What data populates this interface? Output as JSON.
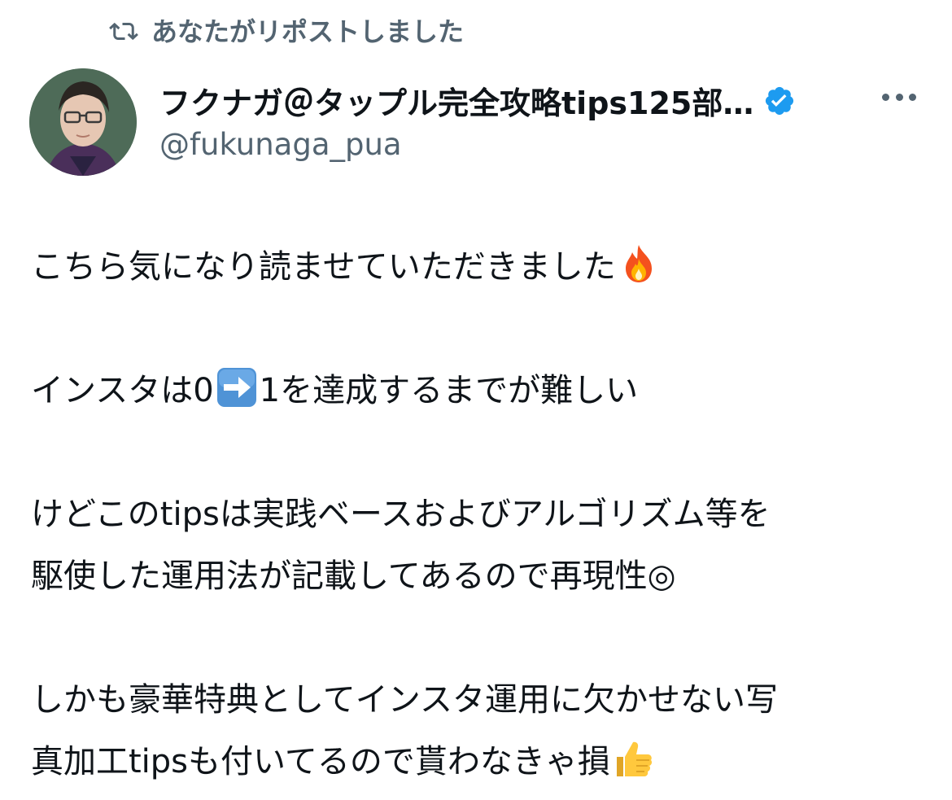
{
  "repost": {
    "icon": "repost-icon",
    "label": "あなたがリポストしました"
  },
  "author": {
    "display_name": "フクナガ＠タップル完全攻略tips125部…",
    "handle": "@fukunaga_pua",
    "verified": true,
    "avatar_icon": "avatar"
  },
  "menu": {
    "icon": "more-icon"
  },
  "tweet": {
    "line1_text": "こちら気になり読ませていただきました",
    "line1_emoji": "fire-emoji",
    "line2_a": "インスタは0",
    "line2_emoji": "right-arrow-emoji",
    "line2_b": "1を達成するまでが難しい",
    "line3": "けどこのtipsは実践ベースおよびアルゴリズム等を",
    "line4": "駆使した運用法が記載してあるので再現性◎",
    "line5": "しかも豪華特典としてインスタ運用に欠かせない写",
    "line6_text": "真加工tipsも付いてるので貰わなきゃ損",
    "line6_emoji": "thumbs-up-emoji"
  },
  "colors": {
    "secondary_text": "#536471",
    "verified_blue": "#1d9bf0",
    "primary_text": "#0f1419"
  }
}
